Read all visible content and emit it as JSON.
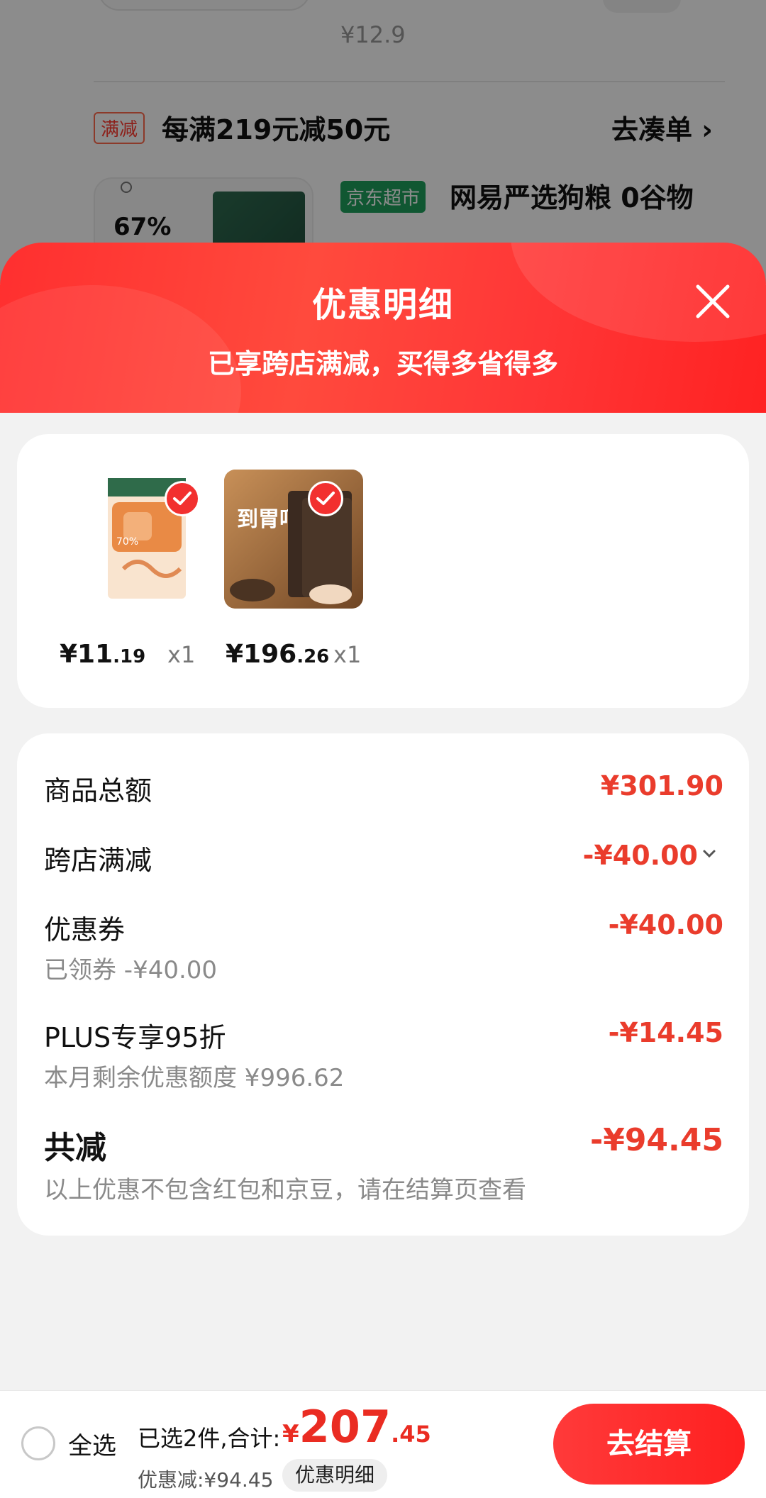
{
  "background_cart": {
    "prev_price": "¥12.9",
    "promo_tag": "满减",
    "promo_text": "每满219元减50元",
    "promo_link": "去凑单 ›",
    "product_pct": "67%",
    "store_tag": "京东超市",
    "product_title": "网易严选狗粮 0谷物"
  },
  "sheet": {
    "title": "优惠明细",
    "subtitle": "已享跨店满减，买得多省得多",
    "close_icon": "close-icon"
  },
  "products": [
    {
      "price_int": "¥11",
      "price_dec": ".19",
      "qty": "x1",
      "thumb_text": "70%"
    },
    {
      "price_int": "¥196",
      "price_dec": ".26",
      "qty": "x1",
      "thumb_text": "到胃呵护"
    }
  ],
  "summary": {
    "goods_total_label": "商品总额",
    "goods_total_value": "¥301.90",
    "cross_store_label": "跨店满减",
    "cross_store_value": "-¥40.00",
    "coupon_label": "优惠券",
    "coupon_sub": "已领券 -¥40.00",
    "coupon_value": "-¥40.00",
    "plus_label": "PLUS专享95折",
    "plus_sub": "本月剩余优惠额度 ¥996.62",
    "plus_value": "-¥14.45",
    "total_label": "共减",
    "total_sub": "以上优惠不包含红包和京豆，请在结算页查看",
    "total_value": "-¥94.45"
  },
  "bottom": {
    "select_all": "全选",
    "selected_text": "已选2件,合计:",
    "total_yen": "¥",
    "total_int": "207",
    "total_dec": ".45",
    "discount_text": "优惠减:¥94.45",
    "detail_pill": "优惠明细",
    "checkout": "去结算"
  },
  "colors": {
    "accent_red": "#ea3c2c",
    "header_red": "#ff2f2f"
  }
}
